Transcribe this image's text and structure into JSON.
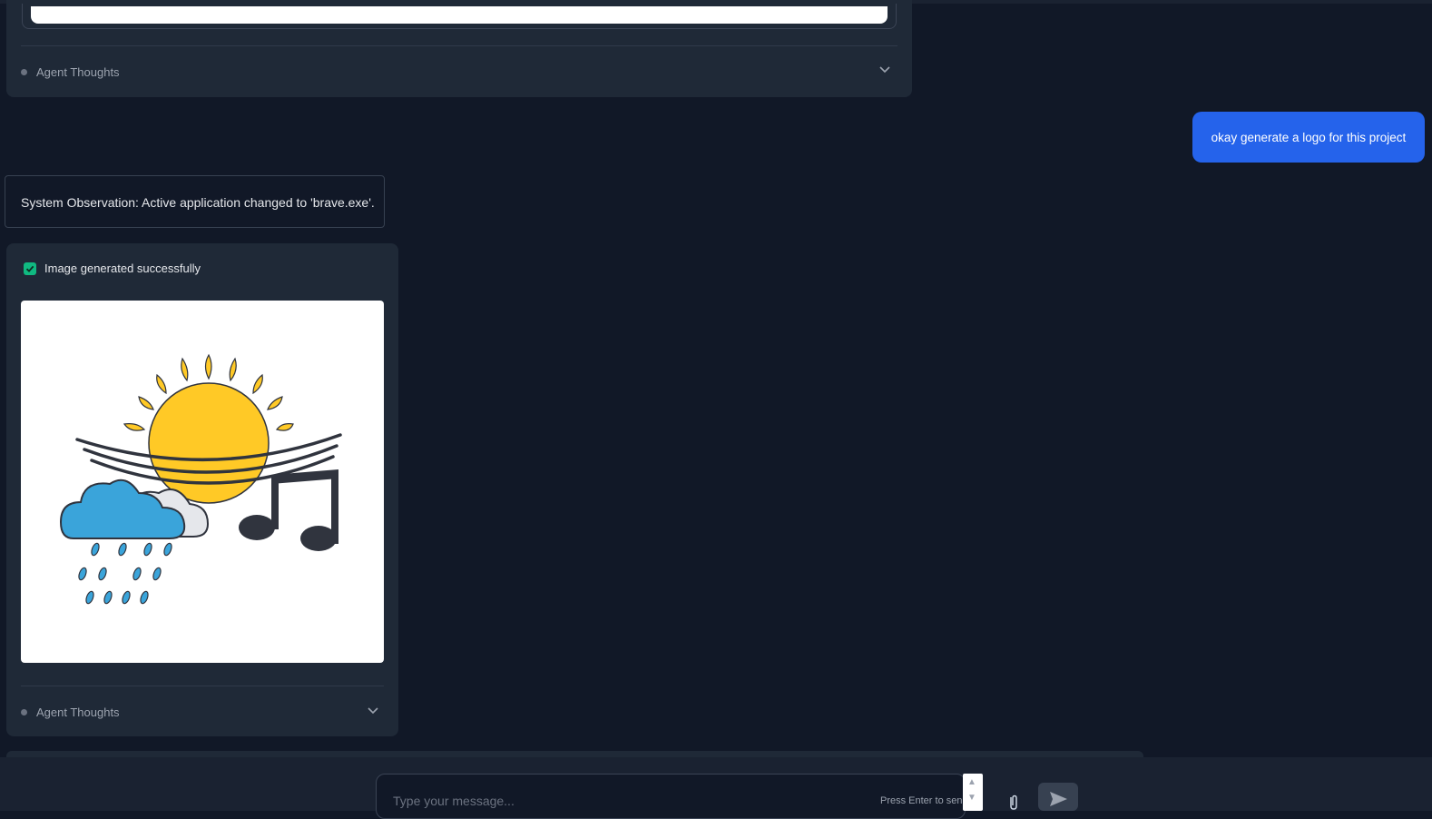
{
  "top_panel": {
    "agent_thoughts_label": "Agent Thoughts"
  },
  "user_message": {
    "text": "okay generate a logo for this project"
  },
  "system_observation": {
    "text": "System Observation: Active application changed to 'brave.exe'."
  },
  "image_panel": {
    "status_text": "Image generated successfully",
    "agent_thoughts_label": "Agent Thoughts"
  },
  "composer": {
    "placeholder": "Type your message...",
    "hint": "Press Enter to send"
  },
  "colors": {
    "background": "#111827",
    "card": "#1f2937",
    "user_bubble": "#2563eb",
    "success": "#10b981",
    "sun": "#FFC926",
    "cloud_blue": "#3AA4DA",
    "music_note": "#30343e"
  },
  "icons": {
    "chevron": "chevron-down-icon",
    "check": "check-icon",
    "attach": "paperclip-icon",
    "send": "send-icon"
  }
}
